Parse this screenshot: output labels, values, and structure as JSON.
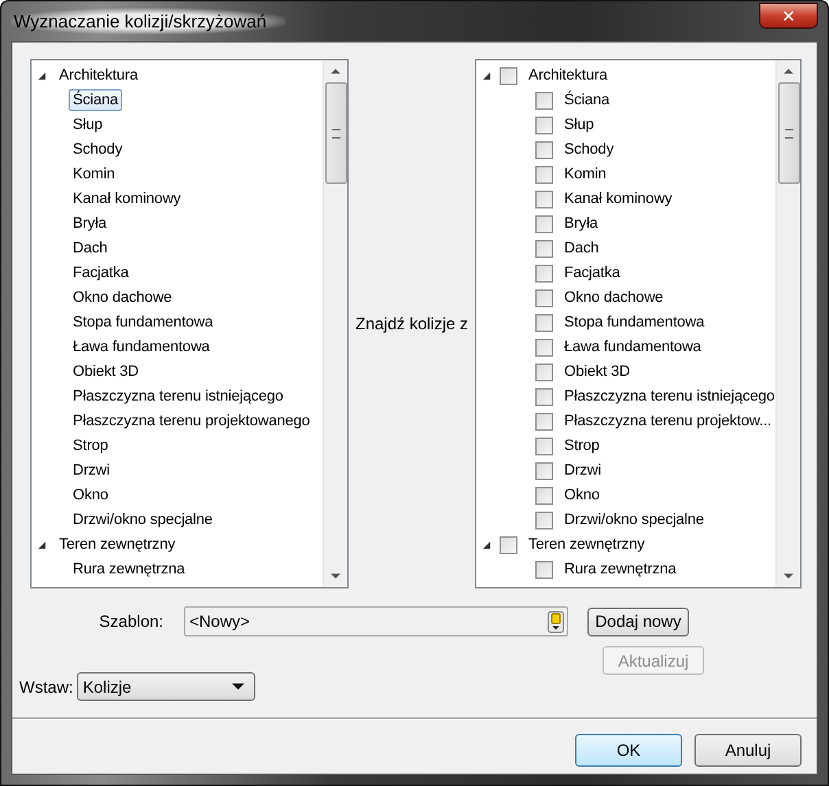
{
  "window": {
    "title": "Wyznaczanie kolizji/skrzyżowań",
    "close": "✕"
  },
  "left_tree": [
    {
      "label": "Architektura",
      "expanded": true,
      "selected": false,
      "children": [
        {
          "label": "Ściana",
          "selected": true
        },
        {
          "label": "Słup",
          "selected": false
        },
        {
          "label": "Schody",
          "selected": false
        },
        {
          "label": "Komin",
          "selected": false
        },
        {
          "label": "Kanał kominowy",
          "selected": false
        },
        {
          "label": "Bryła",
          "selected": false
        },
        {
          "label": "Dach",
          "selected": false
        },
        {
          "label": "Facjatka",
          "selected": false
        },
        {
          "label": "Okno dachowe",
          "selected": false
        },
        {
          "label": "Stopa fundamentowa",
          "selected": false
        },
        {
          "label": "Ława fundamentowa",
          "selected": false
        },
        {
          "label": "Obiekt 3D",
          "selected": false
        },
        {
          "label": "Płaszczyzna terenu istniejącego",
          "selected": false
        },
        {
          "label": "Płaszczyzna terenu projektowanego",
          "selected": false
        },
        {
          "label": "Strop",
          "selected": false
        },
        {
          "label": "Drzwi",
          "selected": false
        },
        {
          "label": "Okno",
          "selected": false
        },
        {
          "label": "Drzwi/okno specjalne",
          "selected": false
        }
      ]
    },
    {
      "label": "Teren zewnętrzny",
      "expanded": true,
      "selected": false,
      "children": [
        {
          "label": "Rura zewnętrzna",
          "selected": false
        }
      ]
    }
  ],
  "middle_label": "Znajdź kolizje z",
  "right_tree": [
    {
      "label": "Architektura",
      "expanded": true,
      "checked": false,
      "children": [
        {
          "label": "Ściana",
          "checked": false
        },
        {
          "label": "Słup",
          "checked": false
        },
        {
          "label": "Schody",
          "checked": false
        },
        {
          "label": "Komin",
          "checked": false
        },
        {
          "label": "Kanał kominowy",
          "checked": false
        },
        {
          "label": "Bryła",
          "checked": false
        },
        {
          "label": "Dach",
          "checked": false
        },
        {
          "label": "Facjatka",
          "checked": false
        },
        {
          "label": "Okno dachowe",
          "checked": false
        },
        {
          "label": "Stopa fundamentowa",
          "checked": false
        },
        {
          "label": "Ława fundamentowa",
          "checked": false
        },
        {
          "label": "Obiekt 3D",
          "checked": false
        },
        {
          "label": "Płaszczyzna terenu istniejącego",
          "checked": false
        },
        {
          "label": "Płaszczyzna terenu projektow...",
          "checked": false
        },
        {
          "label": "Strop",
          "checked": false
        },
        {
          "label": "Drzwi",
          "checked": false
        },
        {
          "label": "Okno",
          "checked": false
        },
        {
          "label": "Drzwi/okno specjalne",
          "checked": false
        }
      ]
    },
    {
      "label": "Teren zewnętrzny",
      "expanded": true,
      "checked": false,
      "children": [
        {
          "label": "Rura zewnętrzna",
          "checked": false
        }
      ]
    }
  ],
  "template": {
    "label": "Szablon:",
    "value": "<Nowy>"
  },
  "add_button": {
    "label": "Dodaj nowy",
    "disabled": false
  },
  "update_button": {
    "label": "Aktualizuj",
    "disabled": true
  },
  "insert": {
    "label": "Wstaw:",
    "value": "Kolizje"
  },
  "buttons": [
    {
      "label": "OK",
      "default": true
    },
    {
      "label": "Anuluj",
      "default": false
    }
  ]
}
